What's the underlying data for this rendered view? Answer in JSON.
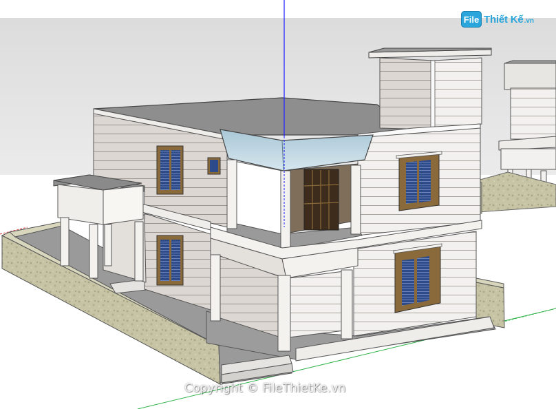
{
  "watermark": {
    "logo_badge": "File",
    "logo_name": "Thiết Kế",
    "logo_suffix": ".vn",
    "copyright": "Copyright © FileThietKe.vn"
  },
  "colors": {
    "sky": "#e3e3e3",
    "ground": "#ffffff",
    "wall_light": "#f3f1ef",
    "wall_shade": "#dad6d2",
    "siding_line": "#9a9690",
    "roof": "#8e8e8e",
    "fence": "#c8c6a8",
    "floor": "#9c9c9c",
    "window_glass": "#2b4a88",
    "window_frame": "#8a6a3a",
    "blue_axis": "#1a1aff",
    "red_axis": "#d23b3b",
    "green_axis": "#2fb34a"
  }
}
